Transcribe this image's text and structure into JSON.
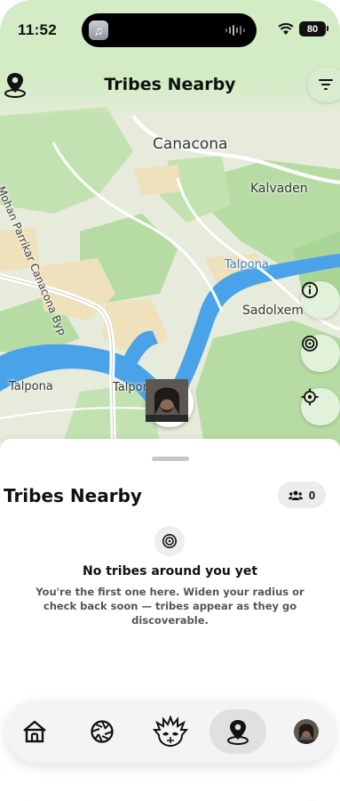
{
  "status_bar": {
    "time": "11:52",
    "battery": "80"
  },
  "header": {
    "title": "Tribes Nearby"
  },
  "map": {
    "labels": {
      "canacona": "Canacona",
      "kalvaden": "Kalvaden",
      "talpona_river_north": "Talpona",
      "sadolxem": "Sadolxem",
      "talpona_west": "Talpona",
      "talpona_center": "Talpona",
      "road": "Mohan Parrikar Canacona Byp"
    },
    "colors": {
      "water": "#4aa3e8",
      "land": "#e7ebdc",
      "park": "#b6dca4",
      "urban": "#efe1bb",
      "road": "#ffffff"
    }
  },
  "sheet": {
    "title": "Tribes Nearby",
    "count": "0",
    "empty_title": "No tribes around you yet",
    "empty_text": "You're the first one here. Widen your radius or check back soon — tribes appear as they go discoverable."
  },
  "tabbar": {
    "items": [
      {
        "icon": "home-icon"
      },
      {
        "icon": "aperture-icon"
      },
      {
        "icon": "tribal-mask-icon"
      },
      {
        "icon": "nearby-pin-icon",
        "selected": true
      },
      {
        "icon": "profile-avatar"
      }
    ]
  },
  "accent_colors": {
    "header_bg": "#d2ecc4",
    "button_bg": "#e2f1d9",
    "marker_tip": "#4aa3e8"
  }
}
